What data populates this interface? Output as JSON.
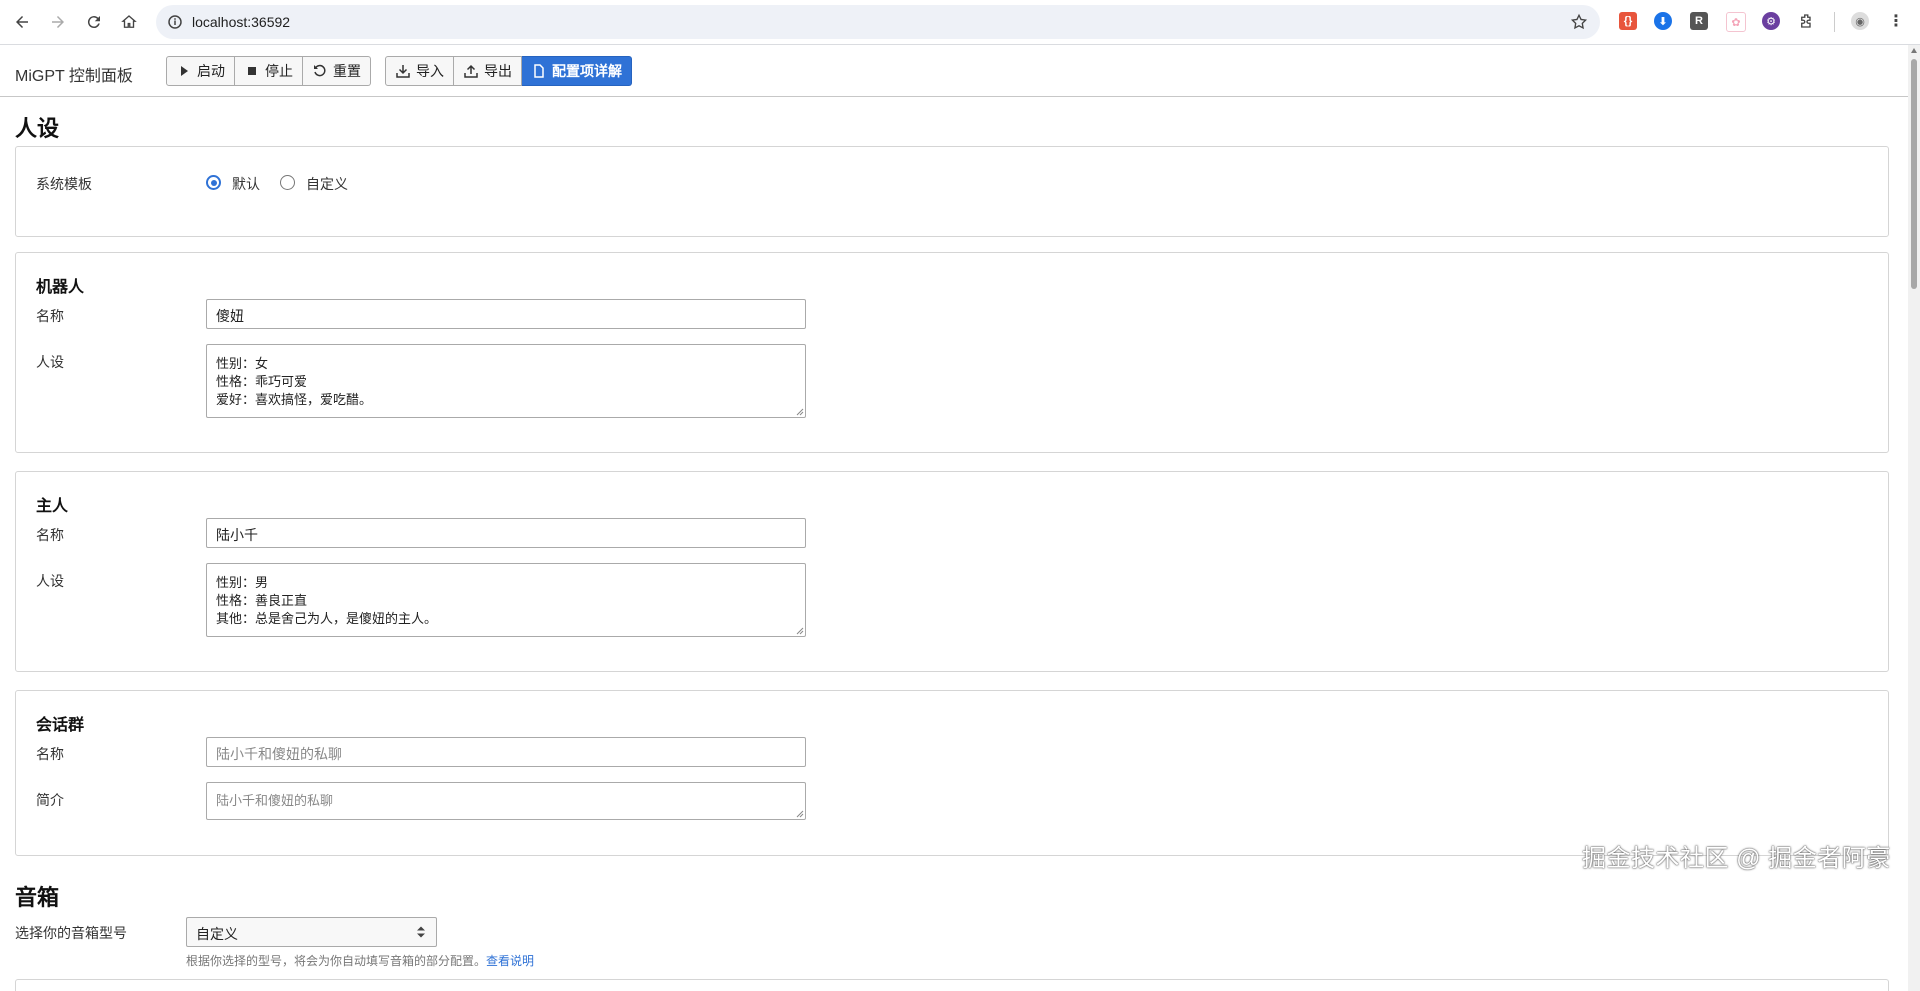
{
  "browser": {
    "url": "localhost:36592",
    "extensions": [
      "json-viewer-icon",
      "download-icon",
      "r-icon",
      "pink-ext-icon",
      "purple-ext-icon",
      "puzzle-icon"
    ]
  },
  "toolbar": {
    "title": "MiGPT 控制面板",
    "start_label": "启动",
    "stop_label": "停止",
    "reset_label": "重置",
    "import_label": "导入",
    "export_label": "导出",
    "config_detail_label": "配置项详解",
    "accent_color": "#2f72d6"
  },
  "persona": {
    "heading": "人设",
    "system_template_label": "系统模板",
    "option_default": "默认",
    "option_custom": "自定义",
    "selected": "默认"
  },
  "bot": {
    "heading": "机器人",
    "name_label": "名称",
    "name_value": "傻妞",
    "profile_label": "人设",
    "profile_value": "性别：女\n性格：乖巧可爱\n爱好：喜欢搞怪，爱吃醋。"
  },
  "master": {
    "heading": "主人",
    "name_label": "名称",
    "name_value": "陆小千",
    "profile_label": "人设",
    "profile_value": "性别：男\n性格：善良正直\n其他：总是舍己为人，是傻妞的主人。"
  },
  "room": {
    "heading": "会话群",
    "name_label": "名称",
    "name_placeholder": "陆小千和傻妞的私聊",
    "desc_label": "简介",
    "desc_placeholder": "陆小千和傻妞的私聊"
  },
  "speaker": {
    "heading": "音箱",
    "model_label": "选择你的音箱型号",
    "model_value": "自定义",
    "hint_text": "根据你选择的型号，将会为你自动填写音箱的部分配置。",
    "hint_link": "查看说明"
  },
  "watermark": "掘金技术社区 @ 掘金者阿豪"
}
